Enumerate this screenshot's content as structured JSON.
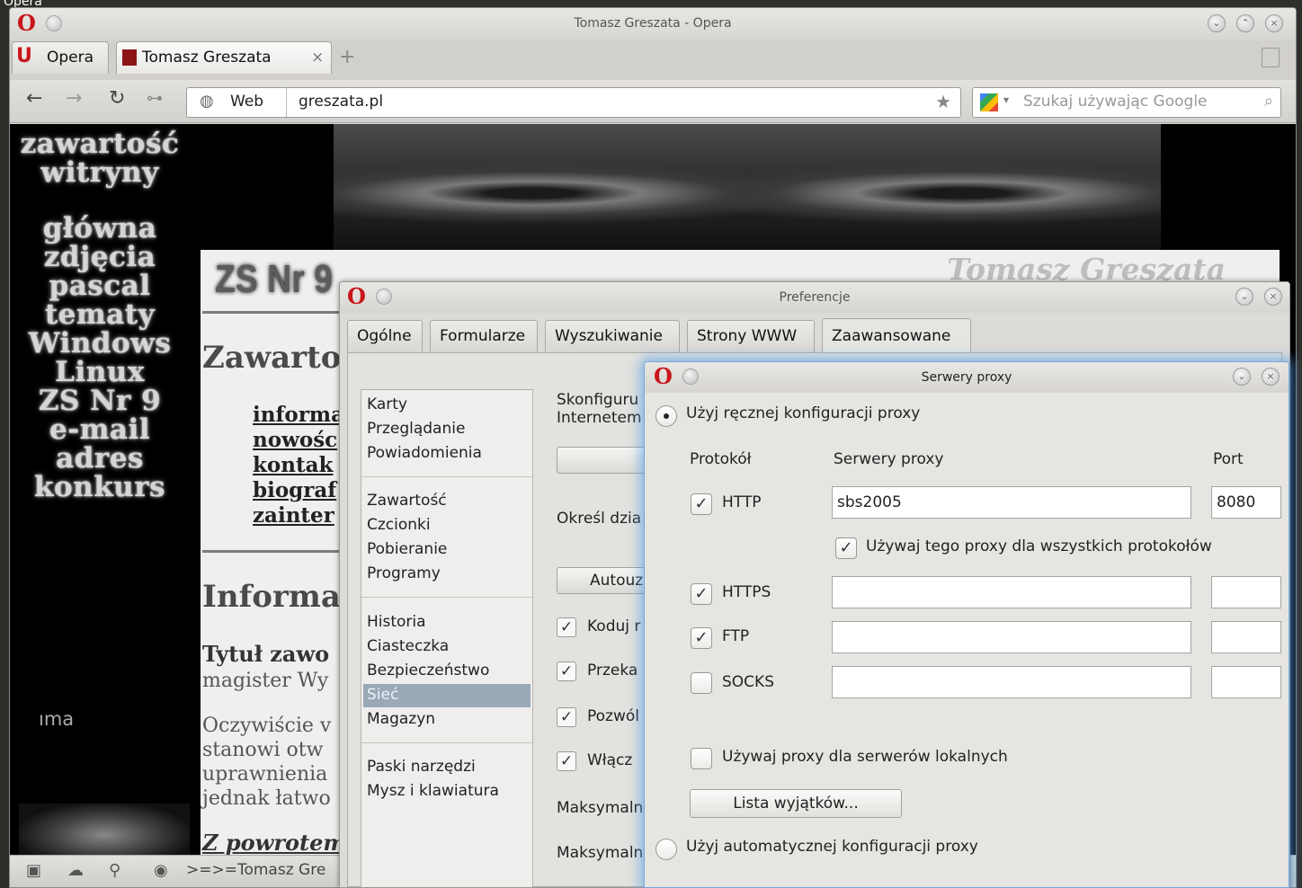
{
  "desktop": {
    "label": "Opera"
  },
  "browser": {
    "window_title": "Tomasz Greszata - Opera",
    "menu_button": "Opera",
    "tab_title": "Tomasz Greszata",
    "tab_close": "×",
    "new_tab": "+",
    "address_label": "Web",
    "url": "greszata.pl",
    "search_placeholder": "Szukaj używając Google",
    "status_text": ">=>=Tomasz Gre"
  },
  "website": {
    "nav_heading": [
      "zawartość",
      "witryny"
    ],
    "nav_links": [
      "główna",
      "zdjęcia",
      "pascal",
      "tematy",
      "Windows",
      "Linux",
      "ZS Nr 9",
      "e-mail",
      "adres",
      "konkurs"
    ],
    "site_name": "Tomasz Greszata",
    "logo_text": "ZS Nr 9",
    "heading1": "Zawarto",
    "content_links": [
      "informa",
      "nowośc",
      "kontak",
      "biograf",
      "zainter"
    ],
    "heading2": "Informa",
    "subheading": "Tytuł zawo",
    "subtext": "magister Wy",
    "paragraph": [
      "Oczywiście v",
      "stanowi otw",
      "uprawnienia",
      "jednak łatwo"
    ],
    "back_link": "Z powrotem",
    "side_fragment": "ıma"
  },
  "preferences": {
    "title": "Preferencje",
    "tabs": [
      "Ogólne",
      "Formularze",
      "Wyszukiwanie",
      "Strony WWW",
      "Zaawansowane"
    ],
    "active_tab": "Zaawansowane",
    "list_groups": [
      [
        "Karty",
        "Przeglądanie",
        "Powiadomienia"
      ],
      [
        "Zawartość",
        "Czcionki",
        "Pobieranie",
        "Programy"
      ],
      [
        "Historia",
        "Ciasteczka",
        "Bezpieczeństwo",
        "Sieć",
        "Magazyn"
      ],
      [
        "Paski narzędzi",
        "Mysz i klawiatura"
      ]
    ],
    "selected_item": "Sieć",
    "right_text1": "Skonfiguru",
    "right_text2": "Internetem",
    "right_text3": "Określ dzia",
    "button_auto": "Autouz",
    "checks": [
      "Koduj r",
      "Przeka",
      "Pozwól",
      "Włącz"
    ],
    "max1": "Maksymaln",
    "max2": "Maksymaln"
  },
  "proxy": {
    "title": "Serwery proxy",
    "manual_radio": "Użyj ręcznej konfiguracji proxy",
    "col_protocol": "Protokół",
    "col_servers": "Serwery proxy",
    "col_port": "Port",
    "rows": [
      {
        "protocol": "HTTP",
        "server": "sbs2005",
        "port": "8080",
        "checked": "✓"
      },
      {
        "protocol": "HTTPS",
        "server": "",
        "port": "",
        "checked": "✓"
      },
      {
        "protocol": "FTP",
        "server": "",
        "port": "",
        "checked": "✓"
      },
      {
        "protocol": "SOCKS",
        "server": "",
        "port": "",
        "checked": ""
      }
    ],
    "use_for_all": "Używaj tego proxy dla wszystkich protokołów",
    "local_servers": "Używaj proxy dla serwerów lokalnych",
    "exceptions_button": "Lista wyjątków...",
    "auto_radio": "Użyj automatycznej konfiguracji proxy"
  },
  "colors": {
    "accent": "#c8161b",
    "selection": "#9aa8b8",
    "glow": "#5aa0e6"
  }
}
